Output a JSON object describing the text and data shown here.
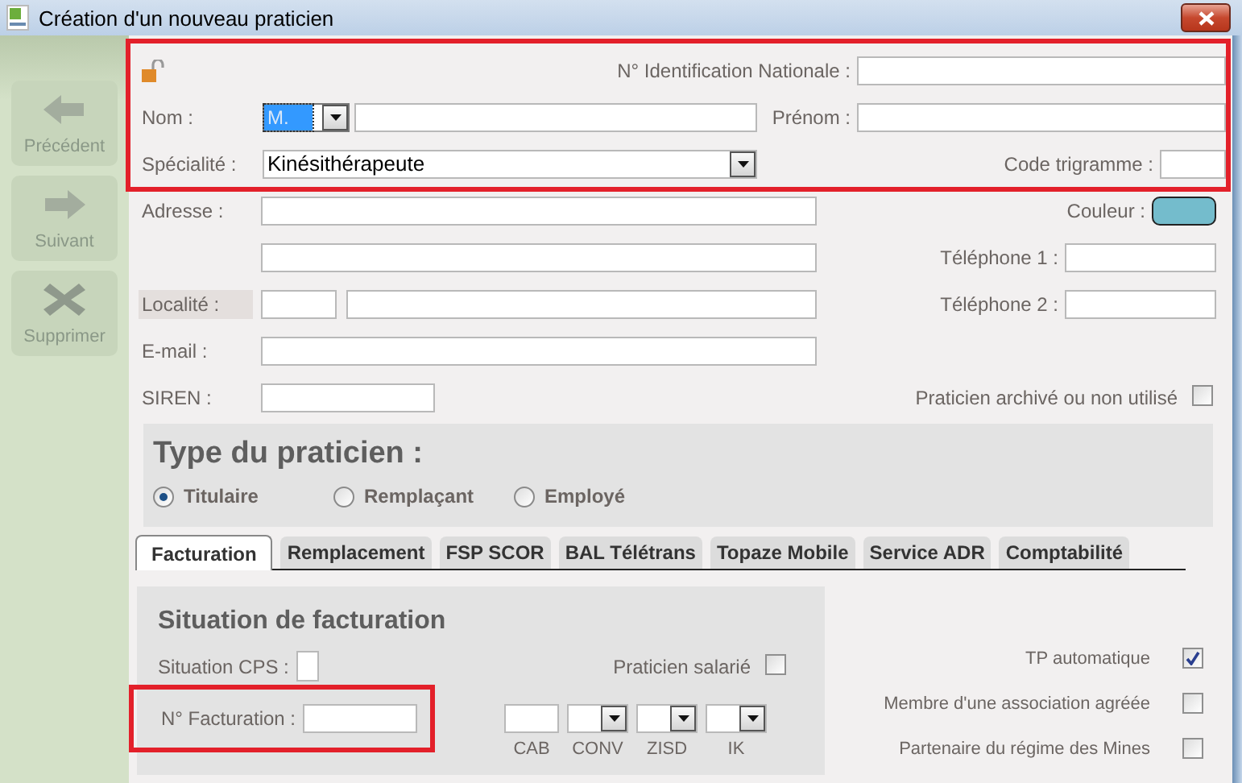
{
  "window": {
    "title": "Création d'un nouveau praticien"
  },
  "sidebar": [
    {
      "label": "Précédent",
      "kind": "previous"
    },
    {
      "label": "Suivant",
      "kind": "next"
    },
    {
      "label": "Supprimer",
      "kind": "delete"
    }
  ],
  "identity": {
    "national_id": {
      "label": "N° Identification Nationale :"
    },
    "nom": {
      "label": "Nom :",
      "civility": "M."
    },
    "prenom": {
      "label": "Prénom :"
    },
    "specialite": {
      "label": "Spécialité :",
      "value": "Kinésithérapeute"
    },
    "code_trigramme": {
      "label": "Code trigramme :"
    }
  },
  "contact": {
    "adresse": {
      "label": "Adresse :"
    },
    "couleur": {
      "label": "Couleur :",
      "color": "#74bccc"
    },
    "telephone_1": {
      "label": "Téléphone 1 :"
    },
    "localite": {
      "label": "Localité :"
    },
    "telephone_2": {
      "label": "Téléphone 2 :"
    },
    "email": {
      "label": "E-mail :"
    },
    "siren": {
      "label": "SIREN :"
    },
    "archived": {
      "label": "Praticien archivé ou non utilisé",
      "checked": false
    }
  },
  "type": {
    "title": "Type du praticien :",
    "options": [
      {
        "label": "Titulaire",
        "selected": true
      },
      {
        "label": "Remplaçant",
        "selected": false
      },
      {
        "label": "Employé",
        "selected": false
      }
    ]
  },
  "tabs": [
    {
      "label": "Facturation",
      "selected": true
    },
    {
      "label": "Remplacement",
      "selected": false
    },
    {
      "label": "FSP SCOR",
      "selected": false
    },
    {
      "label": "BAL Télétrans",
      "selected": false
    },
    {
      "label": "Topaze Mobile",
      "selected": false
    },
    {
      "label": "Service ADR",
      "selected": false
    },
    {
      "label": "Comptabilité",
      "selected": false
    }
  ],
  "billing": {
    "title": "Situation de facturation",
    "situation_cps": {
      "label": "Situation CPS :"
    },
    "salarie": {
      "label": "Praticien salarié",
      "checked": false
    },
    "numero": {
      "label": "N° Facturation :"
    },
    "codes": [
      {
        "label": "CAB",
        "kind": "field"
      },
      {
        "label": "CONV",
        "kind": "dropdown"
      },
      {
        "label": "ZISD",
        "kind": "dropdown"
      },
      {
        "label": "IK",
        "kind": "dropdown"
      }
    ]
  },
  "options": [
    {
      "label": "TP automatique",
      "checked": true
    },
    {
      "label": "Membre d'une association agréée",
      "checked": false
    },
    {
      "label": "Partenaire du régime des Mines",
      "checked": false
    }
  ]
}
